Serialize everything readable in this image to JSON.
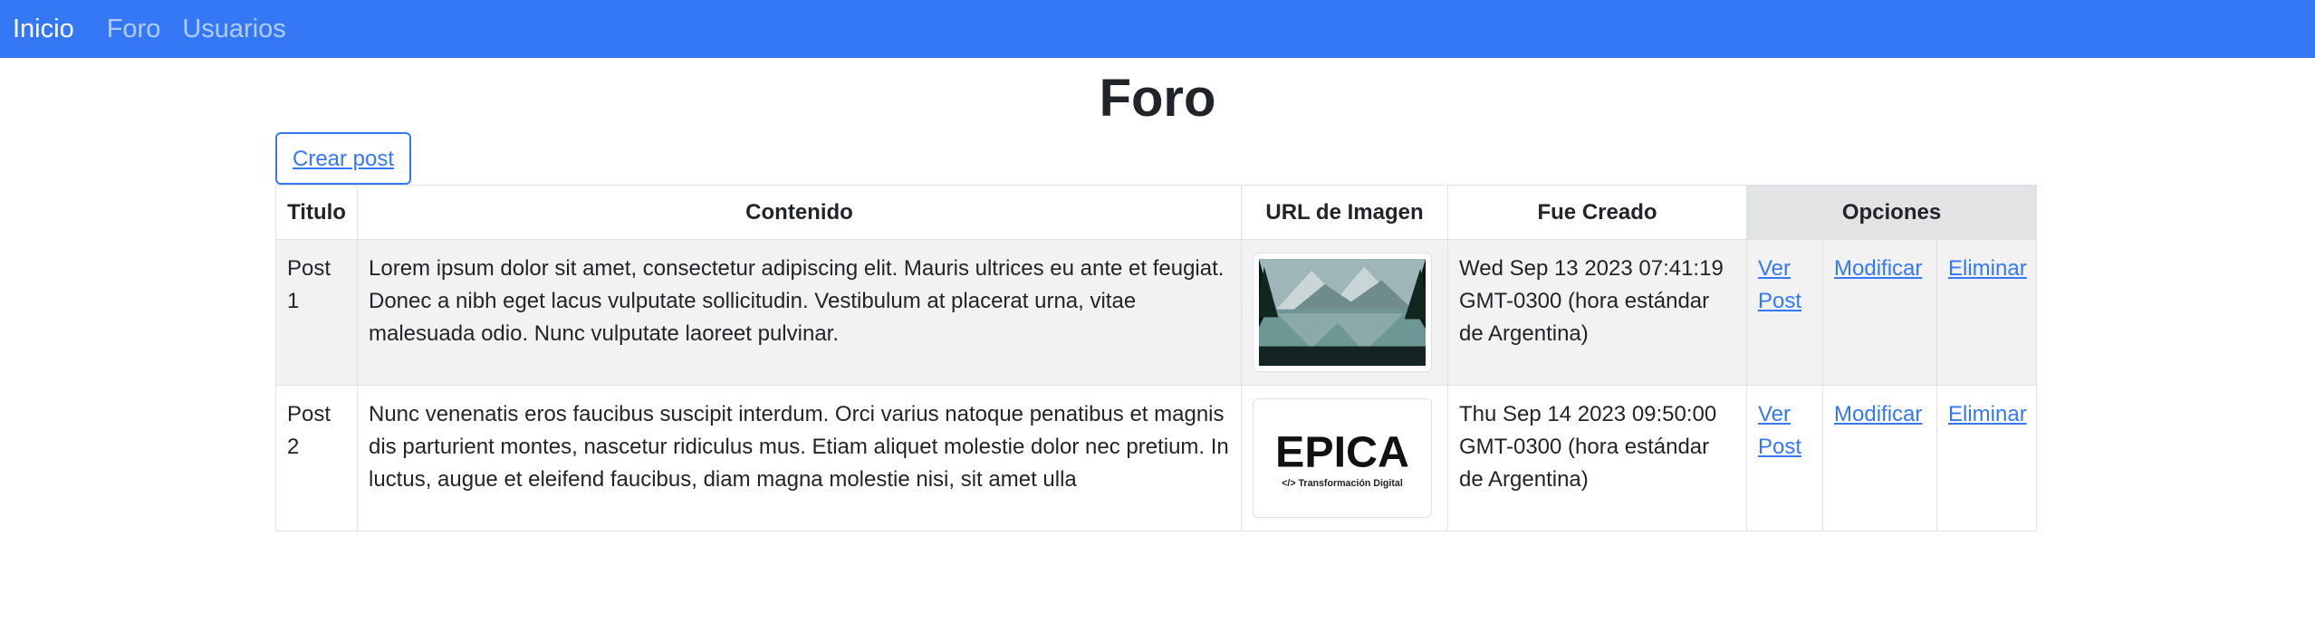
{
  "nav": {
    "brand": "Inicio",
    "links": [
      "Foro",
      "Usuarios"
    ]
  },
  "page": {
    "title": "Foro",
    "create_button": "Crear post"
  },
  "table": {
    "headers": [
      "Titulo",
      "Contenido",
      "URL de Imagen",
      "Fue Creado",
      "Opciones"
    ],
    "rows": [
      {
        "title": "Post 1",
        "content": "Lorem ipsum dolor sit amet, consectetur adipiscing elit. Mauris ultrices eu ante et feugiat. Donec a nibh eget lacus vulputate sollicitudin. Vestibulum at placerat urna, vitae malesuada odio. Nunc vulputate laoreet pulvinar.",
        "created": "Wed Sep 13 2023 07:41:19 GMT-0300 (hora estándar de Argentina)",
        "view": "Ver Post",
        "edit": "Modificar",
        "delete": "Eliminar"
      },
      {
        "title": "Post 2",
        "content": "Nunc venenatis eros faucibus suscipit interdum. Orci varius natoque penatibus et magnis dis parturient montes, nascetur ridiculus mus. Etiam aliquet molestie dolor nec pretium. In luctus, augue et eleifend faucibus, diam magna molestie nisi, sit amet ulla",
        "created": "Thu Sep 14 2023 09:50:00 GMT-0300 (hora estándar de Argentina)",
        "view": "Ver Post",
        "edit": "Modificar",
        "delete": "Eliminar",
        "logo_text": "EPICA",
        "logo_subtext": "</> Transformación Digital"
      }
    ]
  },
  "colors": {
    "navbar": "#3478f6",
    "link": "#3478f6",
    "header_options": "#e2e3e5",
    "stripe": "#f2f2f2"
  }
}
